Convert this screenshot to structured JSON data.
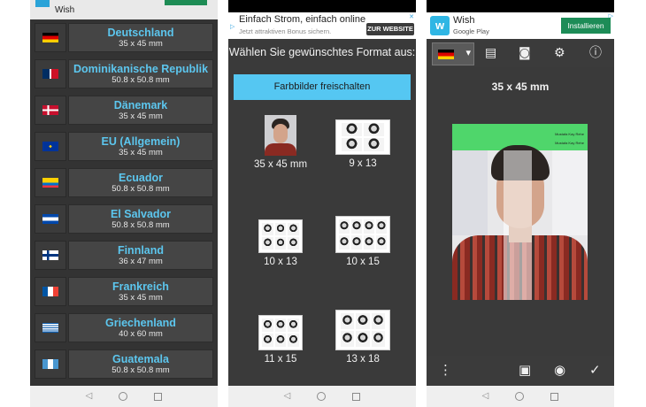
{
  "phone1": {
    "countries": [
      {
        "name": "Deutschland",
        "size": "35 x 45 mm",
        "flag": "de"
      },
      {
        "name": "Dominikanische Republik",
        "size": "50.8 x 50.8 mm",
        "flag": "do"
      },
      {
        "name": "Dänemark",
        "size": "35 x 45 mm",
        "flag": "dk"
      },
      {
        "name": "EU (Allgemein)",
        "size": "35 x 45 mm",
        "flag": "eu"
      },
      {
        "name": "Ecuador",
        "size": "50.8 x 50.8 mm",
        "flag": "ec"
      },
      {
        "name": "El Salvador",
        "size": "50.8 x 50.8 mm",
        "flag": "sv"
      },
      {
        "name": "Finnland",
        "size": "36 x 47 mm",
        "flag": "fi"
      },
      {
        "name": "Frankreich",
        "size": "35 x 45 mm",
        "flag": "fr"
      },
      {
        "name": "Griechenland",
        "size": "40 x 60 mm",
        "flag": "gr"
      },
      {
        "name": "Guatemala",
        "size": "50.8 x 50.8 mm",
        "flag": "gt"
      }
    ],
    "ad_peek": "Wish"
  },
  "phone2": {
    "ad": {
      "title": "Einfach Strom, einfach online",
      "subtitle": "Jetzt attraktiven Bonus sichern.",
      "button": "ZUR WEBSITE"
    },
    "heading": "Wählen Sie gewünschtes Format aus:",
    "unlock_button": "Farbbilder freischalten",
    "formats": [
      {
        "label": "35 x 45 mm"
      },
      {
        "label": "9 x 13"
      },
      {
        "label": "10 x 13"
      },
      {
        "label": "10 x 15"
      },
      {
        "label": "11 x 15"
      },
      {
        "label": "13 x 18"
      }
    ]
  },
  "phone3": {
    "ad": {
      "name": "Wish",
      "store": "Google Play",
      "button": "Installieren",
      "logo_letter": "w"
    },
    "photo_size": "35 x 45 mm",
    "photo_tags": [
      "Mustafa Kay Rehe",
      "Mustafa Kay Rehe"
    ],
    "toolbar_icons": [
      "flag-dropdown",
      "chat-icon",
      "person-icon",
      "gear-icon",
      "info-icon"
    ],
    "bottom_icons": [
      "more-icon",
      "gallery-icon",
      "camera-icon",
      "check-icon"
    ]
  },
  "colors": {
    "accent": "#55c7f2",
    "country_name": "#5cc6ee",
    "install_green": "#1d8c57"
  }
}
